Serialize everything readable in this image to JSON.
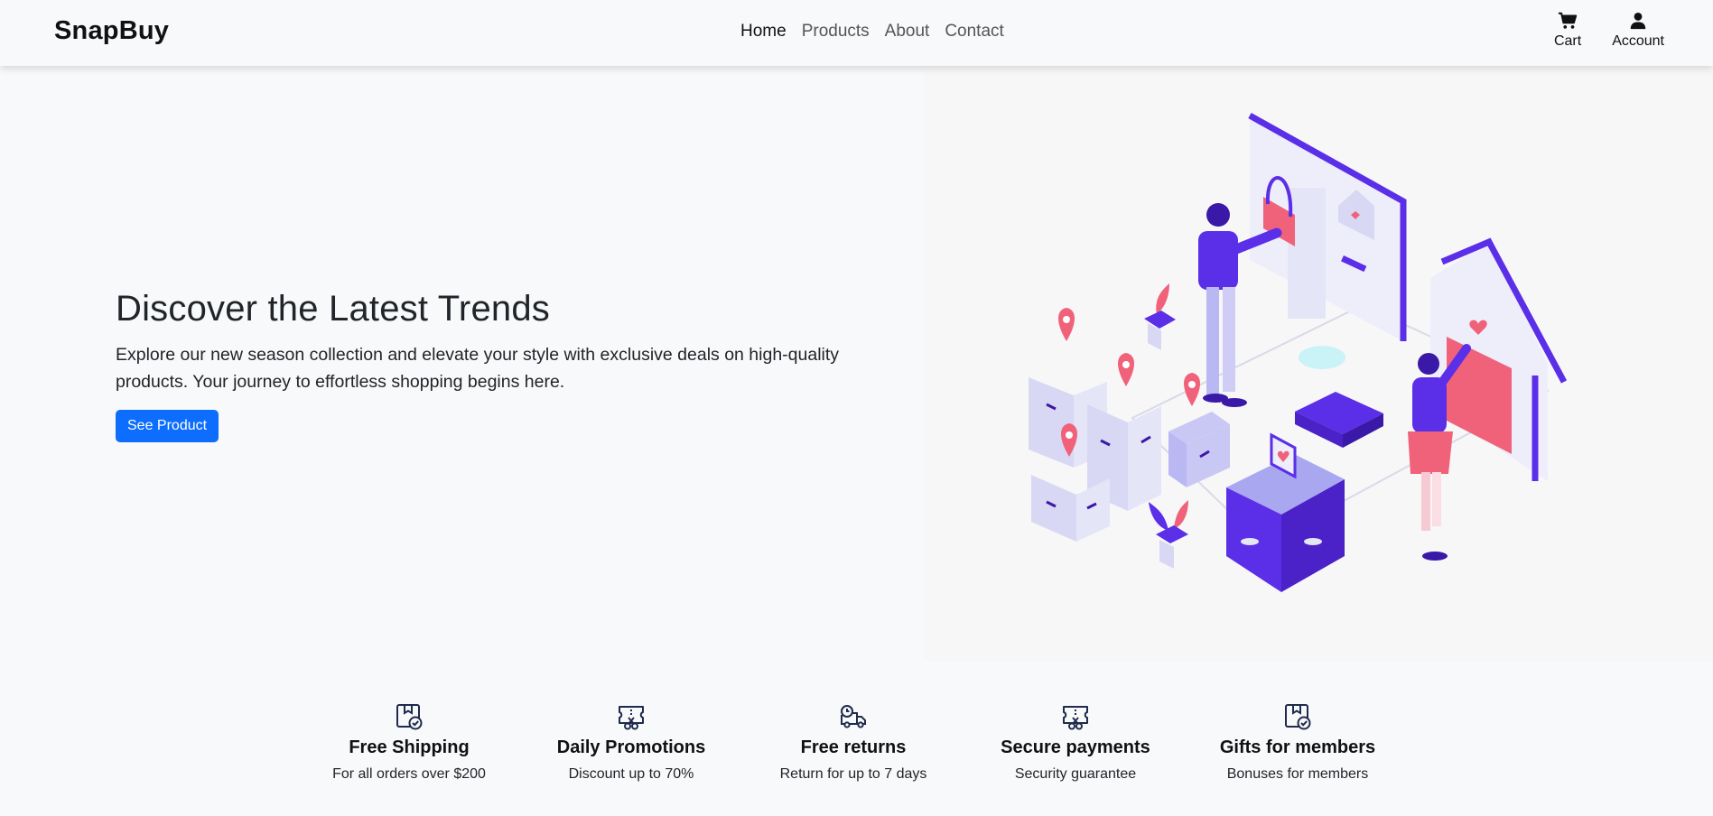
{
  "brand": "SnapBuy",
  "nav": {
    "links": [
      {
        "label": "Home",
        "active": true
      },
      {
        "label": "Products",
        "active": false
      },
      {
        "label": "About",
        "active": false
      },
      {
        "label": "Contact",
        "active": false
      }
    ],
    "actions": [
      {
        "label": "Cart",
        "icon": "cart-icon"
      },
      {
        "label": "Account",
        "icon": "user-icon"
      }
    ]
  },
  "hero": {
    "title": "Discover the Latest Trends",
    "description": "Explore our new season collection and elevate your style with exclusive deals on high-quality products. Your journey to effortless shopping begins here.",
    "button_label": "See Product",
    "illustration": "isometric-online-shopping-illustration"
  },
  "features": [
    {
      "icon": "box-check-icon",
      "title": "Free Shipping",
      "subtitle": "For all orders over $200"
    },
    {
      "icon": "ticket-scissors-icon",
      "title": "Daily Promotions",
      "subtitle": "Discount up to 70%"
    },
    {
      "icon": "delivery-truck-icon",
      "title": "Free returns",
      "subtitle": "Return for up to 7 days"
    },
    {
      "icon": "ticket-scissors-icon",
      "title": "Secure payments",
      "subtitle": "Security guarantee"
    },
    {
      "icon": "box-check-icon",
      "title": "Gifts for members",
      "subtitle": "Bonuses for members"
    }
  ],
  "colors": {
    "primary": "#0d6efd",
    "illustration_purple": "#5b2ee8",
    "illustration_pink": "#f0627a",
    "illustration_lavender": "#b9b8f3"
  }
}
